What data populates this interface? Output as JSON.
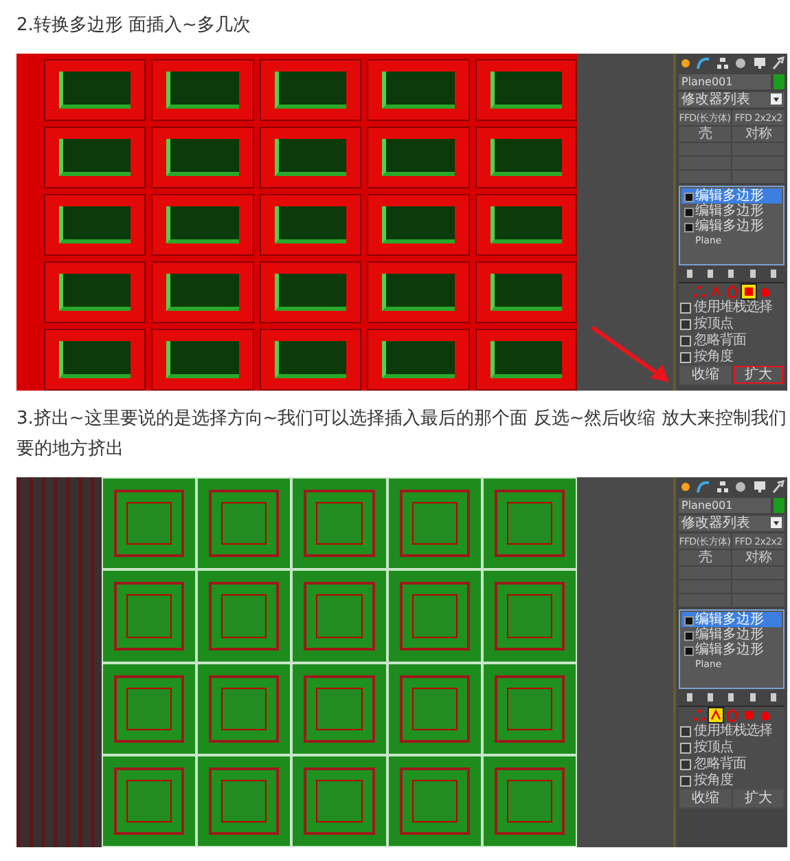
{
  "sections": [
    {
      "caption": "2.转换多边形 面插入~多几次",
      "screenshot": {
        "kind": "windows",
        "annotation": true,
        "object_name": "Plane001",
        "modifier_list": "修改器列表",
        "modifier_buttons": [
          "FFD(长方体)",
          "FFD 2x2x2",
          "壳",
          "对称"
        ],
        "stack": [
          {
            "kind": "modifier",
            "label": "编辑多边形",
            "selected": true
          },
          {
            "kind": "modifier",
            "label": "编辑多边形",
            "selected": false
          },
          {
            "kind": "modifier",
            "label": "编辑多边形",
            "selected": false
          },
          {
            "kind": "base",
            "label": "Plane",
            "selected": false
          }
        ],
        "levels": [
          {
            "kind": "vertex",
            "selected": false
          },
          {
            "kind": "edge",
            "selected": false
          },
          {
            "kind": "border",
            "selected": false
          },
          {
            "kind": "polygon",
            "selected": true
          },
          {
            "kind": "element",
            "selected": false
          }
        ],
        "options": [
          {
            "label": "使用堆栈选择",
            "checked": false
          },
          {
            "label": "按顶点",
            "checked": false
          },
          {
            "label": "忽略背面",
            "checked": false
          },
          {
            "label": "按角度",
            "checked": false
          }
        ],
        "grow_shrink": [
          "收缩",
          "扩大"
        ]
      }
    },
    {
      "caption": "3.挤出~这里要说的是选择方向~我们可以选择插入最后的那个面 反选~然后收缩 放大来控制我们要的地方挤出",
      "screenshot": {
        "kind": "panels",
        "object_name": "Plane001",
        "modifier_list": "修改器列表",
        "modifier_buttons": [
          "FFD(长方体)",
          "FFD 2x2x2",
          "壳",
          "对称"
        ],
        "stack": [
          {
            "kind": "modifier",
            "label": "编辑多边形",
            "selected": true
          },
          {
            "kind": "modifier",
            "label": "编辑多边形",
            "selected": false
          },
          {
            "kind": "modifier",
            "label": "编辑多边形",
            "selected": false
          },
          {
            "kind": "base",
            "label": "Plane",
            "selected": false
          }
        ],
        "levels": [
          {
            "kind": "vertex",
            "selected": false
          },
          {
            "kind": "edge",
            "selected": true
          },
          {
            "kind": "border",
            "selected": false
          },
          {
            "kind": "polygon",
            "selected": false
          },
          {
            "kind": "element",
            "selected": false
          }
        ],
        "options": [
          {
            "label": "使用堆栈选择",
            "checked": false
          },
          {
            "label": "按顶点",
            "checked": false
          },
          {
            "label": "忽略背面",
            "checked": false
          },
          {
            "label": "按角度",
            "checked": false
          }
        ],
        "grow_shrink": [
          "收缩",
          "扩大"
        ]
      }
    }
  ]
}
